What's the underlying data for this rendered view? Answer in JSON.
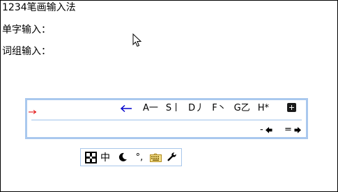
{
  "document": {
    "title_line": "1234笔画输入法",
    "single_char_label": "单字输入：",
    "phrase_label": "词组输入："
  },
  "ime_window": {
    "back_icon": "left-arrow-icon",
    "stroke_keys": [
      "A一",
      "S丨",
      "D丿",
      "F丶",
      "G乙",
      "H*"
    ],
    "expand_icon": "plus-icon",
    "prev_page_label": "-",
    "next_page_label": "=",
    "colors": {
      "border": "#a9c8ee",
      "caret": "#e00000",
      "back_arrow": "#0000cc"
    }
  },
  "status_bar": {
    "mode_label": "中",
    "icons": [
      "ime-logo-icon",
      "chinese-mode-icon",
      "half-width-moon-icon",
      "chinese-punctuation-icon",
      "soft-keyboard-icon",
      "settings-wrench-icon"
    ],
    "punctuation_label": "°,"
  }
}
